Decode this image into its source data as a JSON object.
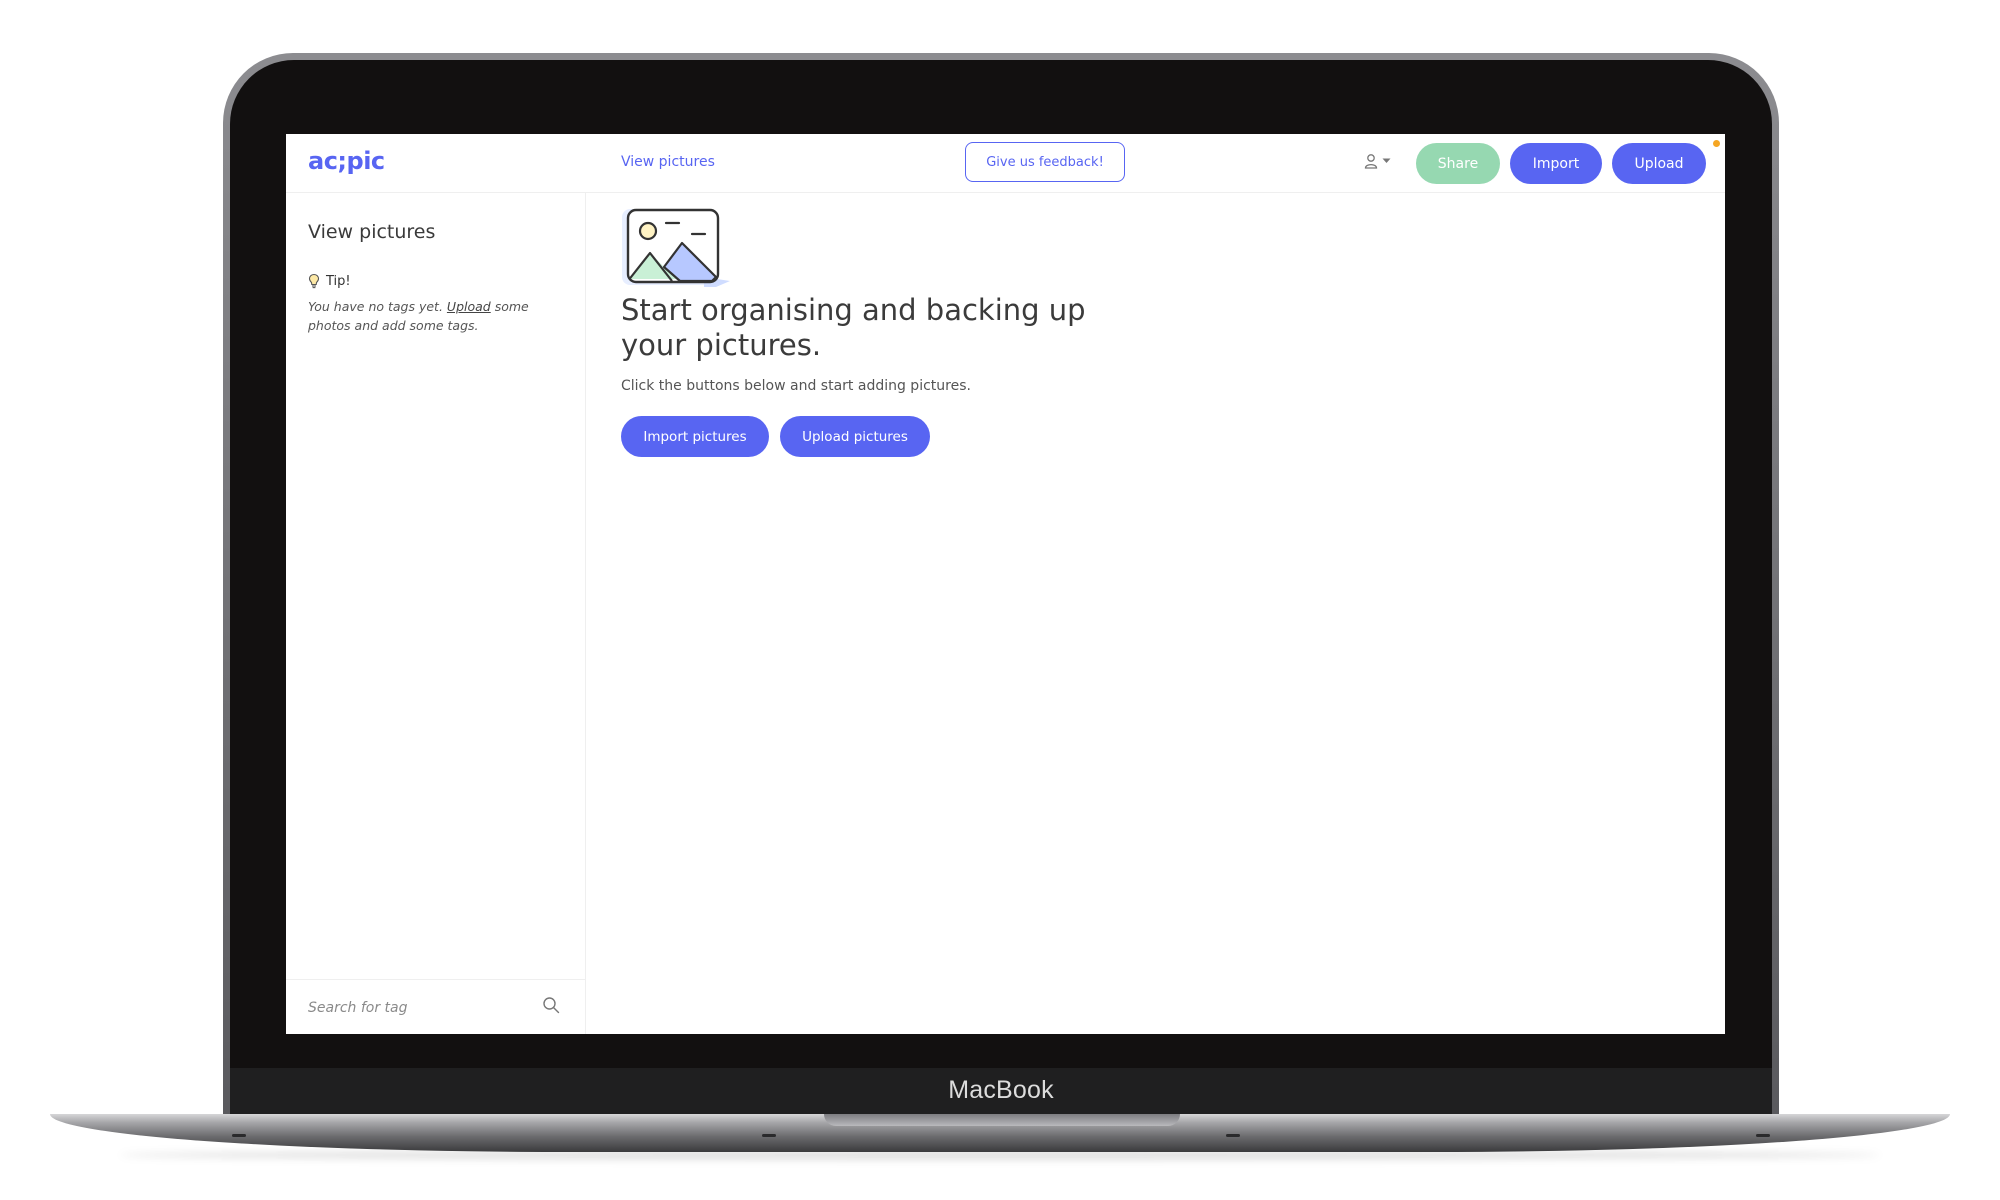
{
  "device": {
    "brand_label": "MacBook"
  },
  "app": {
    "logo": "ac;pic",
    "header": {
      "nav_link": "View pictures",
      "feedback_button": "Give us feedback!",
      "user_menu_icon": "user-icon",
      "share_button": "Share",
      "import_button": "Import",
      "upload_button": "Upload"
    },
    "sidebar": {
      "title": "View pictures",
      "tip": {
        "heading": "Tip!",
        "icon": "lightbulb-icon",
        "text_before": "You have no tags yet. ",
        "link_text": "Upload",
        "text_after": " some photos and add some tags."
      },
      "search": {
        "placeholder": "Search for tag",
        "icon": "search-icon"
      }
    },
    "main": {
      "illustration": "picture-icon",
      "headline": "Start organising and backing up your pictures.",
      "subtext": "Click the buttons below and start adding pictures.",
      "import_button": "Import pictures",
      "upload_button": "Upload pictures"
    },
    "colors": {
      "accent": "#5865f2",
      "share": "#96d8b1",
      "notification": "#f5a623"
    }
  }
}
